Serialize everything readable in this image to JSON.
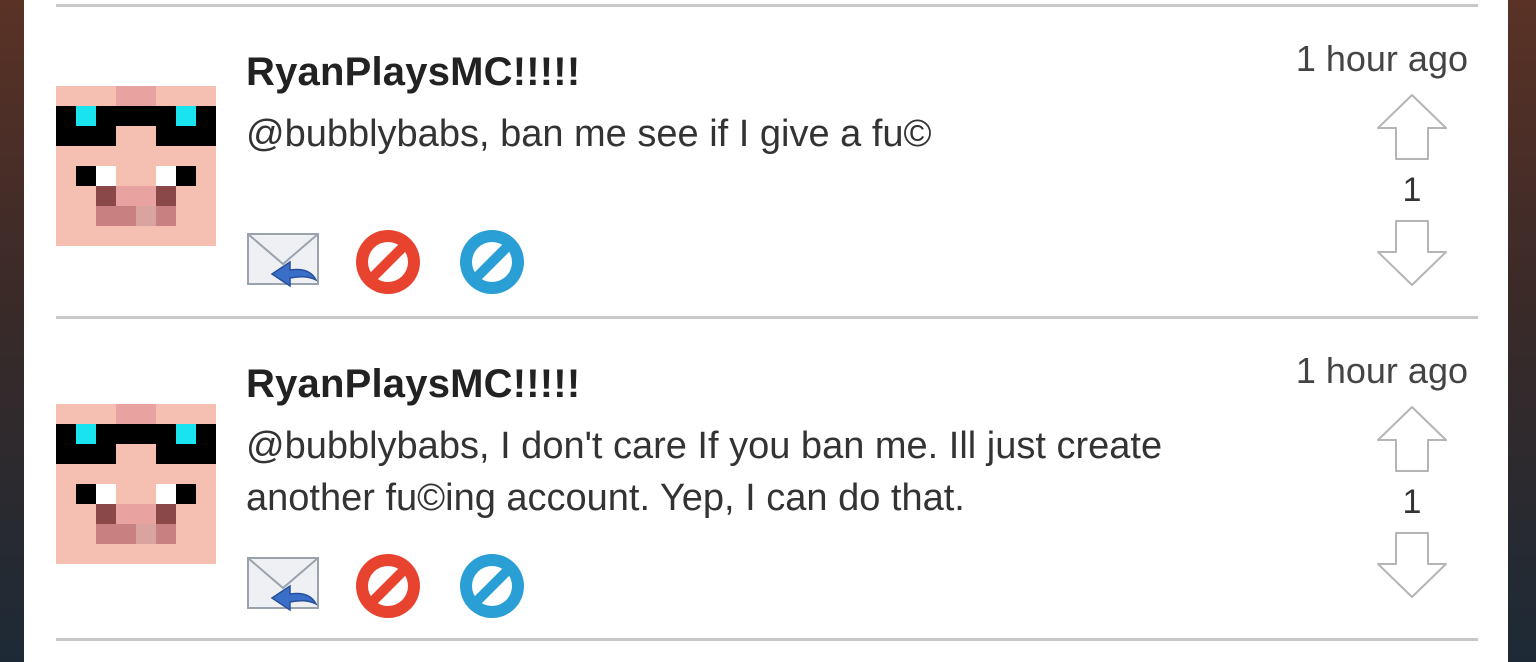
{
  "comments": [
    {
      "username": "RyanPlaysMC!!!!!",
      "message": "@bubblybabs, ban me see if I give a fu©",
      "time": "1 hour ago",
      "votes": "1",
      "avatar_icon": "pig-with-sunglasses-avatar",
      "actions": [
        "reply-mail-icon",
        "ban-red-icon",
        "ban-blue-icon"
      ]
    },
    {
      "username": "RyanPlaysMC!!!!!",
      "message": "@bubblybabs, I don't care If you ban me. Ill just create another fu©ing account. Yep, I can do that.",
      "time": "1 hour ago",
      "votes": "1",
      "avatar_icon": "pig-with-sunglasses-avatar",
      "actions": [
        "reply-mail-icon",
        "ban-red-icon",
        "ban-blue-icon"
      ]
    }
  ],
  "colors": {
    "divider": "#c8c8c8",
    "ban_red": "#e8432f",
    "ban_blue": "#2a9fd6",
    "avatar_skin": "#f5bfb2"
  }
}
